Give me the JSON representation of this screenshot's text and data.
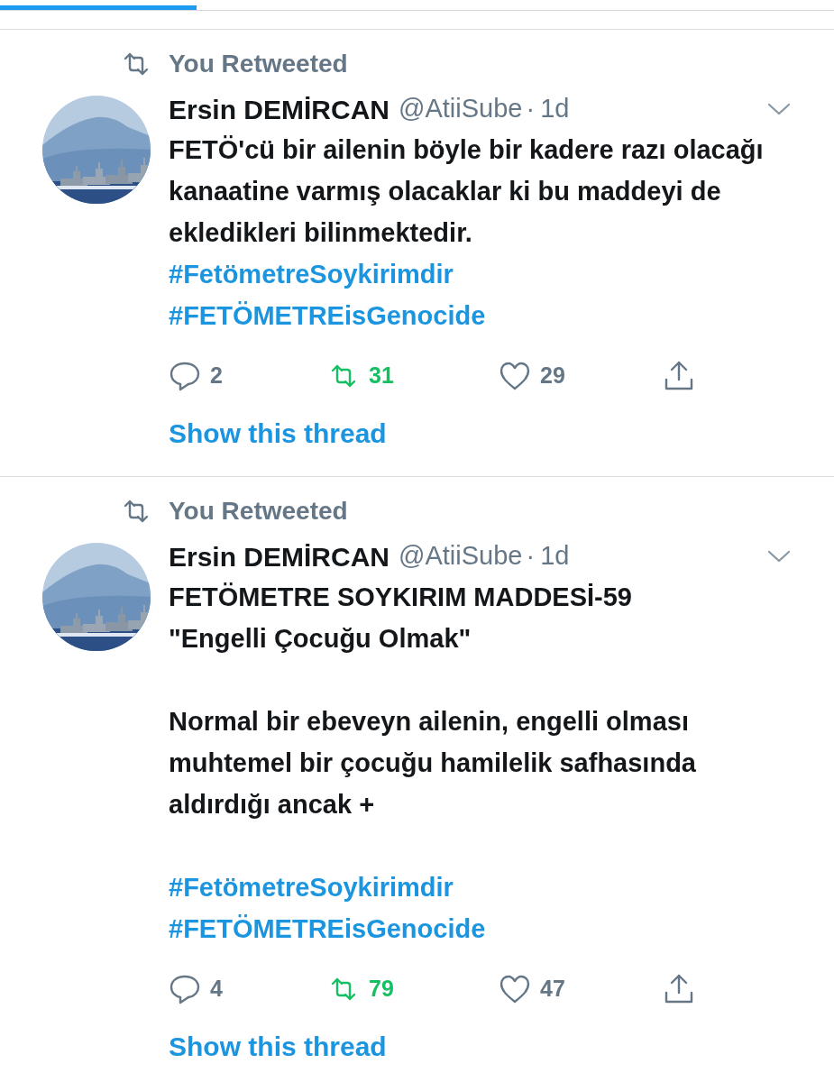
{
  "tweets": [
    {
      "social_context": "You Retweeted",
      "name": "Ersin DEMİRCAN",
      "handle": "@AtiiSube",
      "separator": "·",
      "time": "1d",
      "paragraphs": [
        [
          {
            "kind": "text",
            "text": "FETÖ'cü bir ailenin böyle bir kadere razı olacağı kanaatine varmış olacaklar ki bu maddeyi de ekledikleri bilinmektedir."
          },
          {
            "kind": "hashtag",
            "text": "#FetömetreSoykirimdir"
          },
          {
            "kind": "hashtag",
            "text": "#FETÖMETREisGenocide"
          }
        ]
      ],
      "replies": "2",
      "retweets": "31",
      "retweeted": true,
      "likes": "29",
      "liked": false,
      "thread_link": "Show this thread"
    },
    {
      "social_context": "You Retweeted",
      "name": "Ersin DEMİRCAN",
      "handle": "@AtiiSube",
      "separator": "·",
      "time": "1d",
      "paragraphs": [
        [
          {
            "kind": "text",
            "text": "FETÖMETRE SOYKIRIM MADDESİ-59"
          },
          {
            "kind": "text",
            "text": "\"Engelli Çocuğu Olmak\""
          }
        ],
        [
          {
            "kind": "text",
            "text": "Normal bir ebeveyn ailenin, engelli olması muhtemel bir çocuğu hamilelik safhasında aldırdığı ancak +"
          }
        ],
        [
          {
            "kind": "hashtag",
            "text": "#FetömetreSoykirimdir"
          },
          {
            "kind": "hashtag",
            "text": "#FETÖMETREisGenocide"
          }
        ]
      ],
      "replies": "4",
      "retweets": "79",
      "retweeted": true,
      "likes": "47",
      "liked": false,
      "thread_link": "Show this thread"
    }
  ]
}
